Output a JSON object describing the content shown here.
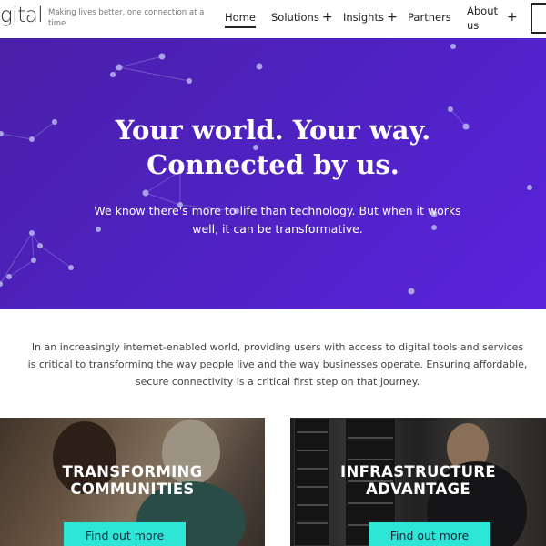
{
  "header": {
    "logo_text": "gital",
    "tagline": "Making lives better, one connection at a time",
    "nav": {
      "home": "Home",
      "solutions": "Solutions",
      "insights": "Insights",
      "partners": "Partners",
      "about": "About us",
      "expand_symbol": "+"
    }
  },
  "hero": {
    "title_line1": "Your world. Your way.",
    "title_line2": "Connected by us.",
    "subtitle": "We know there's more to life than technology. But when it works well, it can be transformative."
  },
  "intro": {
    "text": "In an increasingly internet-enabled world, providing users with access to digital tools and services is critical to transforming the way people live and the way businesses operate. Ensuring affordable, secure connectivity is a critical first step on that journey."
  },
  "cards": [
    {
      "title_line1": "TRANSFORMING",
      "title_line2": "COMMUNITIES",
      "button": "Find out more"
    },
    {
      "title_line1": "INFRASTRUCTURE",
      "title_line2": "ADVANTAGE",
      "button": "Find out more"
    }
  ],
  "colors": {
    "hero_start": "#4a1fa8",
    "hero_end": "#5a23dc",
    "button_accent": "#2ee6d6",
    "node_color": "#a9a2e8"
  }
}
